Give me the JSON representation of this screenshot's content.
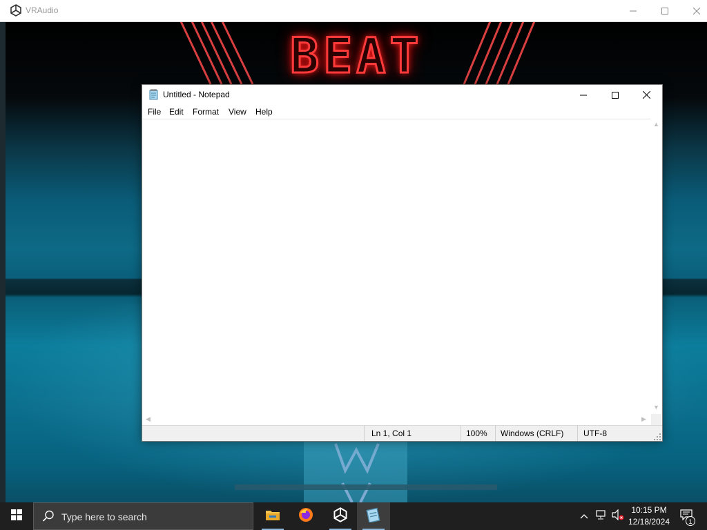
{
  "vr_window": {
    "title": "VRAudio",
    "icon": "unity-icon",
    "scene_sign": "BEAT"
  },
  "notepad": {
    "title": "Untitled - Notepad",
    "icon": "notepad-icon",
    "menu": [
      "File",
      "Edit",
      "Format",
      "View",
      "Help"
    ],
    "text": "",
    "status": {
      "position": "Ln 1, Col 1",
      "zoom": "100%",
      "line_ending": "Windows (CRLF)",
      "encoding": "UTF-8"
    }
  },
  "taskbar": {
    "search_placeholder": "Type here to search",
    "apps": [
      {
        "name": "file-explorer",
        "active": false
      },
      {
        "name": "firefox",
        "active": false
      },
      {
        "name": "unity",
        "active": false
      },
      {
        "name": "notepad",
        "active": true
      }
    ],
    "clock": {
      "time": "10:15 PM",
      "date": "12/18/2024"
    },
    "notifications": "1"
  },
  "colors": {
    "neon_red": "#ff3a3a",
    "taskbar": "#1f1f1f",
    "accent_underline": "#8db6d8"
  }
}
